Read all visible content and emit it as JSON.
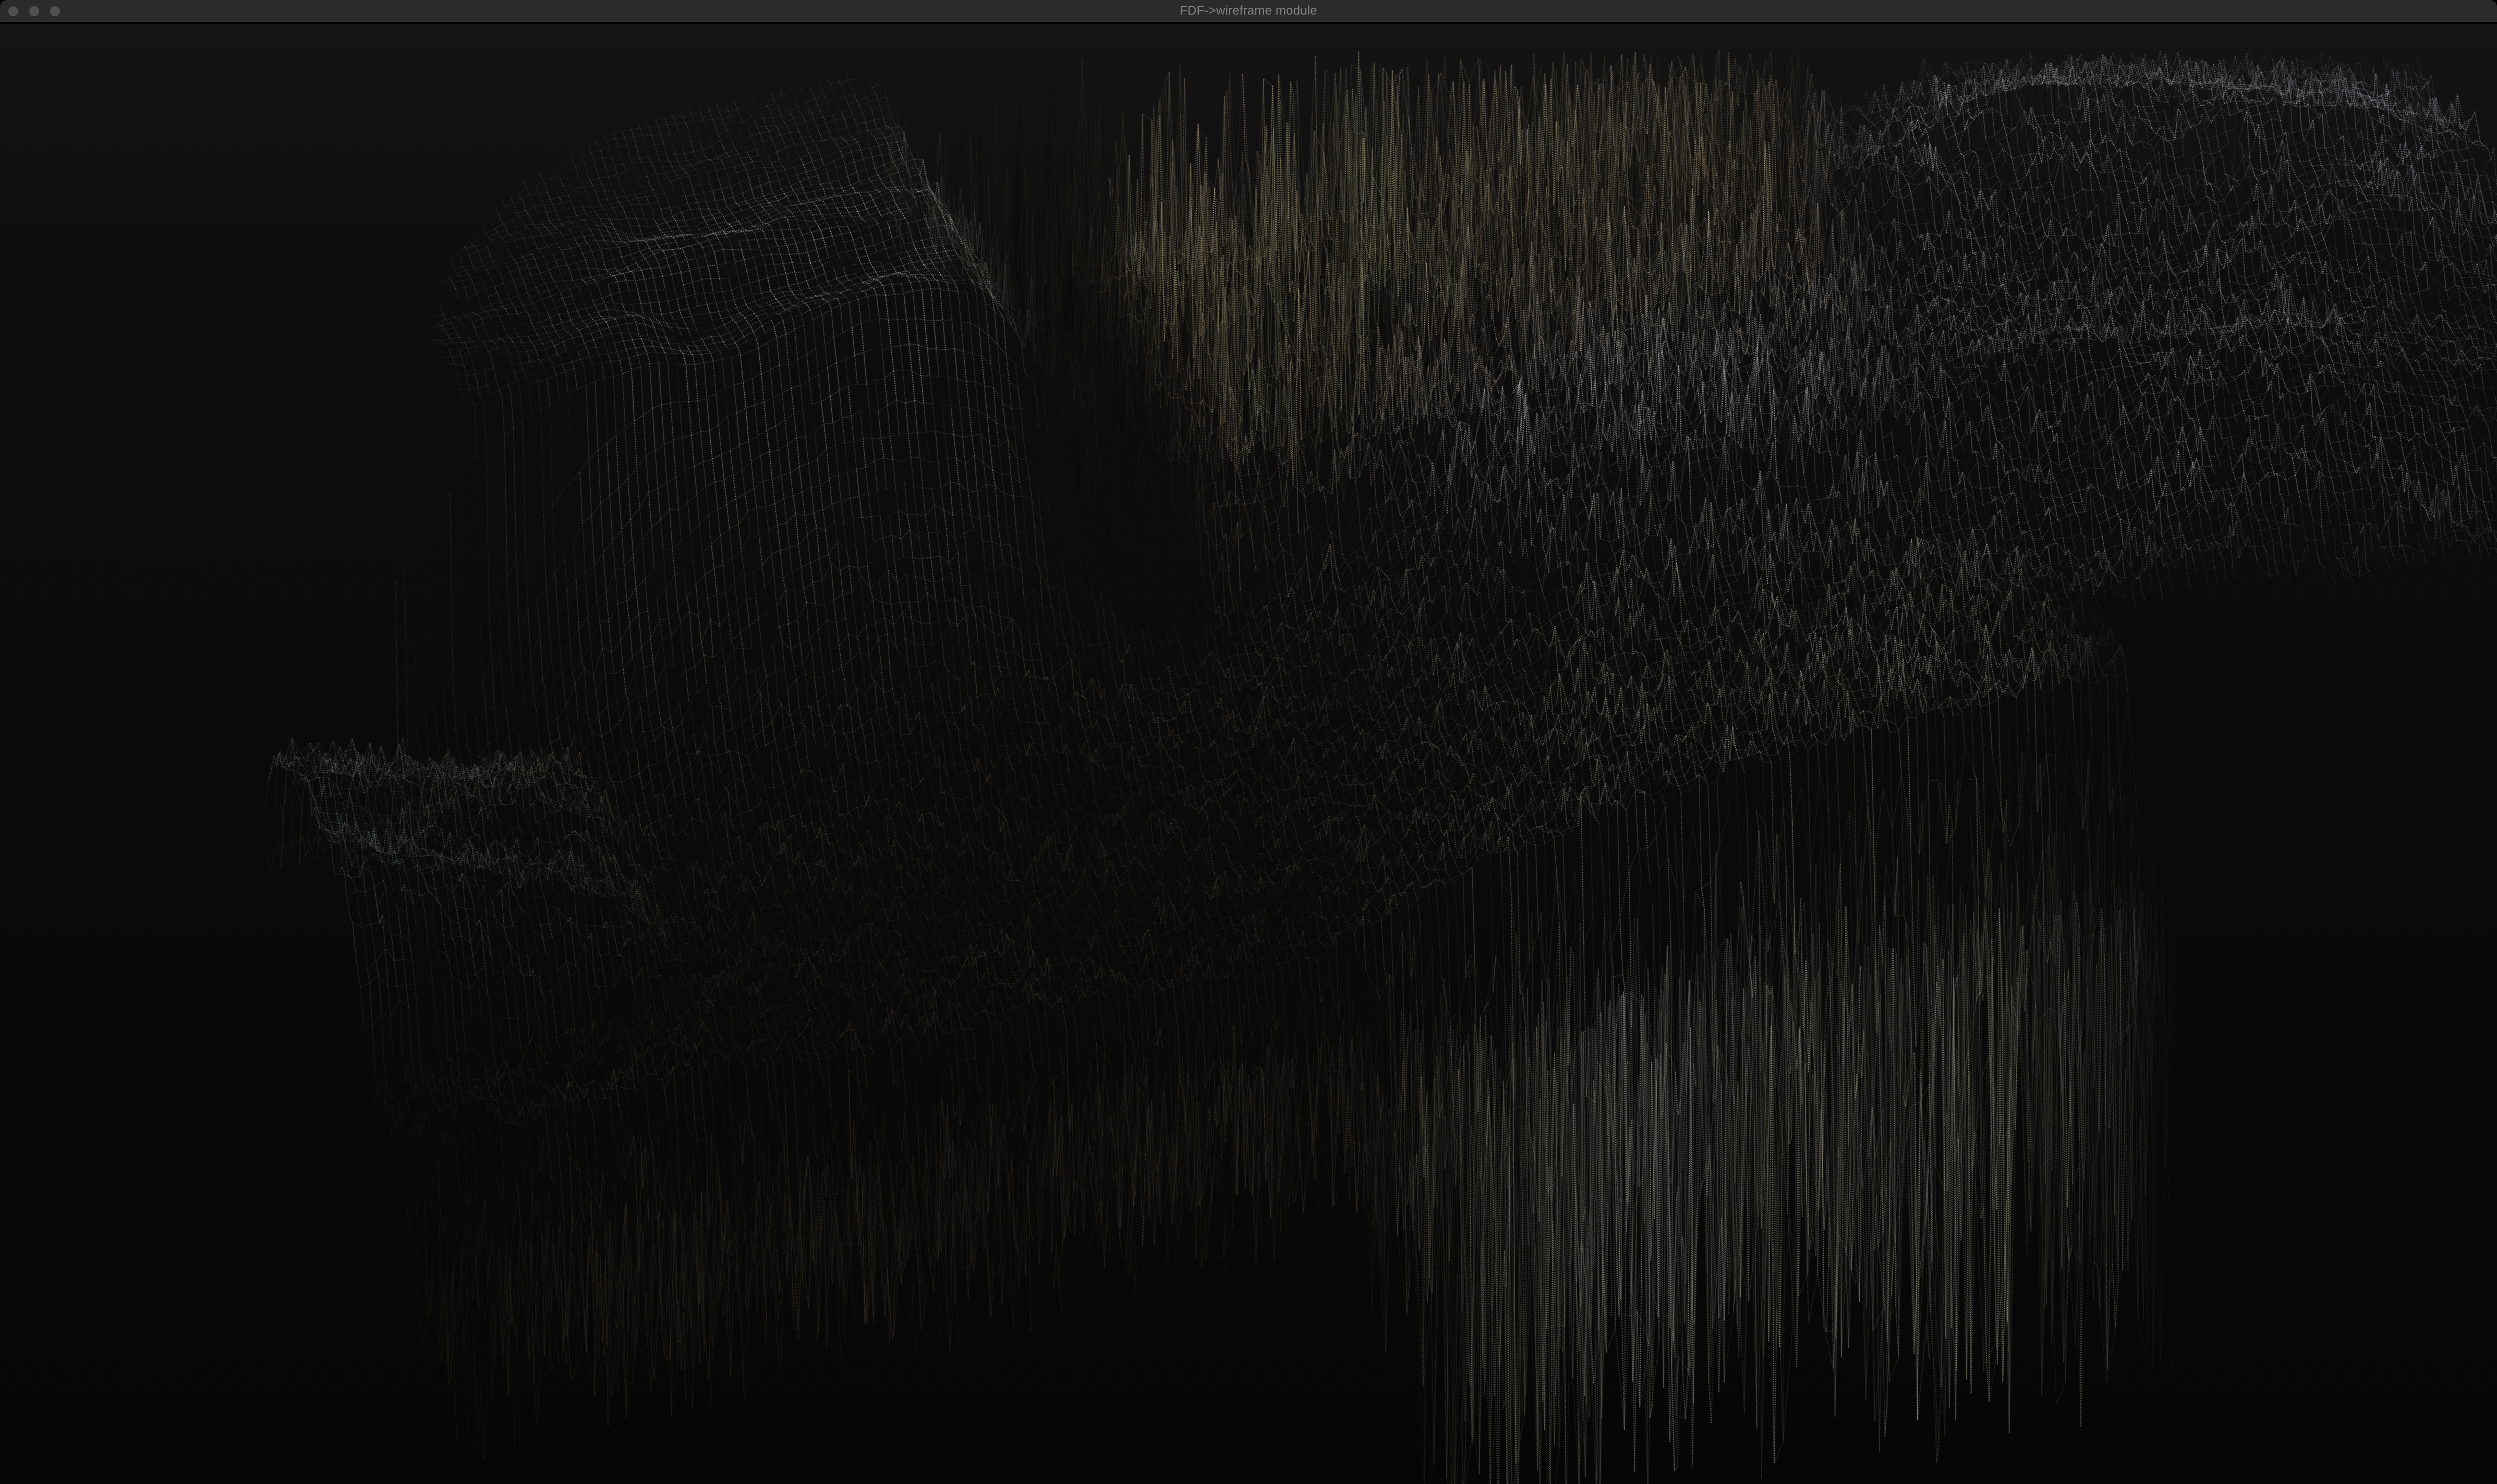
{
  "window": {
    "title": "FDF->wireframe module",
    "titlebar": {
      "background": "#2b2b2b",
      "title_color": "#838383",
      "separator_color": "#000000"
    },
    "controls": [
      {
        "name": "close",
        "color": "#505050"
      },
      {
        "name": "minimize",
        "color": "#505050"
      },
      {
        "name": "zoom",
        "color": "#505050"
      }
    ]
  },
  "viewport": {
    "background": "#0b0b0c"
  },
  "wireframe": {
    "palette": {
      "white_plateau": "#eae8db",
      "snow_white": "#e4e6f2",
      "grass_green": "#a6c784",
      "grass_tan": "#c3a87c",
      "grass_orange": "#cf9a66",
      "plain_brown": "#7d7052",
      "plain_dark": "#403a2f",
      "cyan_ridge": "#a4c5c3",
      "steel_blue": "#8d9fc4",
      "wall_cream": "#dddcbc",
      "wall_white": "#e7e8ec",
      "right_green": "#9cb983"
    }
  }
}
